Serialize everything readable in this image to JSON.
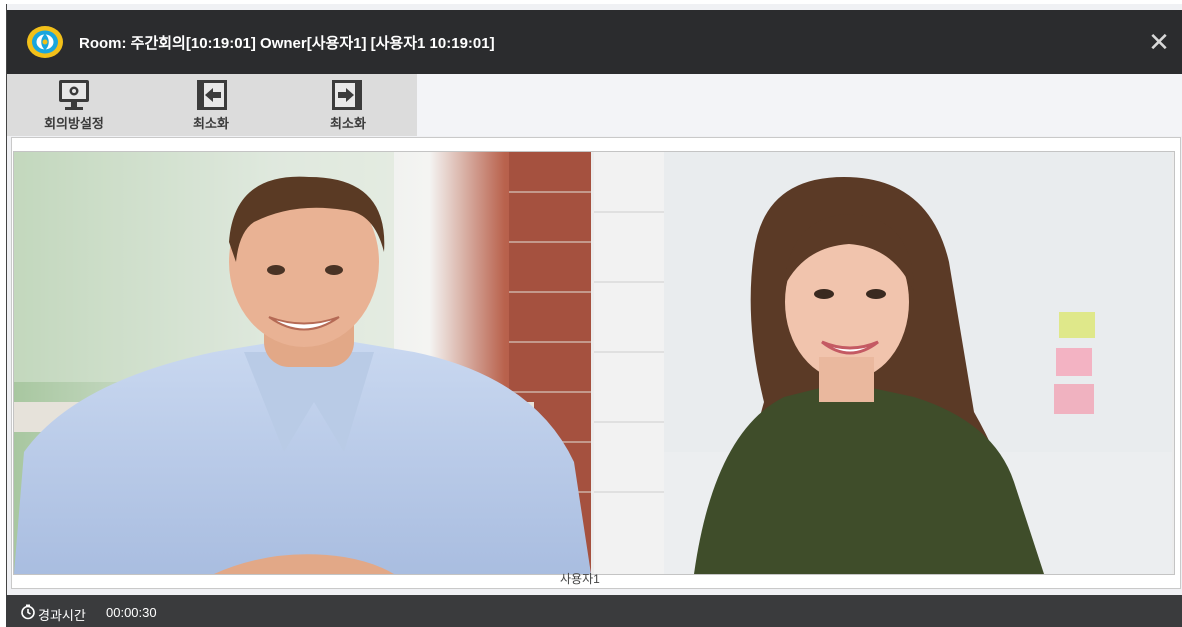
{
  "window": {
    "title": "Room: 주간회의[10:19:01] Owner[사용자1] [사용자1 10:19:01]",
    "close_icon": "close-icon"
  },
  "toolbar": {
    "items": [
      {
        "label": "회의방설정",
        "icon": "monitor-settings-icon"
      },
      {
        "label": "최소화",
        "icon": "exit-left-icon"
      },
      {
        "label": "최소화",
        "icon": "enter-right-icon"
      }
    ]
  },
  "video": {
    "participant_label": "사용자1"
  },
  "status": {
    "elapsed_label": "경과시간",
    "elapsed_value": "00:00:30"
  },
  "colors": {
    "titlebar": "#2b2c2e",
    "toolbar": "#dcdcdc",
    "statusbar": "#3a3b3d"
  }
}
